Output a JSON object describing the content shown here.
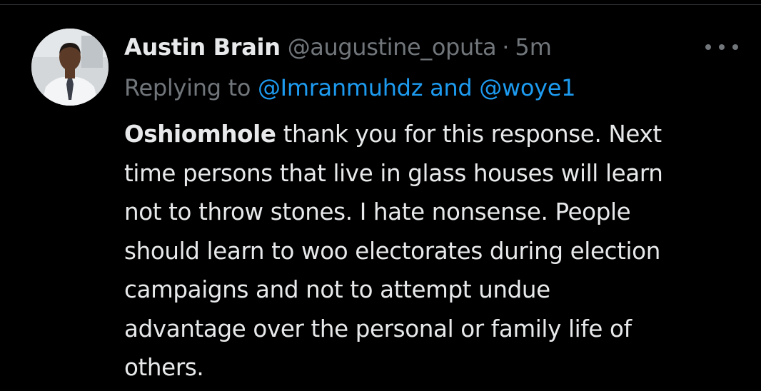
{
  "tweet": {
    "author_name": "Austin Brain",
    "author_handle": "@augustine_oputa",
    "separator": "·",
    "timestamp": "5m",
    "more_icon": "more-horizontal-icon",
    "reply": {
      "prefix": "Replying to",
      "mention_1": "@Imranmuhdz",
      "conjunction": "and",
      "mention_2": "@woye1"
    },
    "text": {
      "bold_lead": "Oshiomhole",
      "line1_rest": " thank you for this response. Next",
      "line2": "time persons that live in glass houses will learn",
      "line3": "not to throw stones. I hate nonsense. People",
      "line4": "should learn to woo electorates during election",
      "line5": "campaigns and not to attempt undue",
      "line6": "advantage over the personal or family life of",
      "line7": "others."
    }
  },
  "colors": {
    "background": "#000000",
    "primary_text": "#e7e9ea",
    "secondary_text": "#71767b",
    "link": "#1d9bf0",
    "divider": "#2f3336"
  }
}
